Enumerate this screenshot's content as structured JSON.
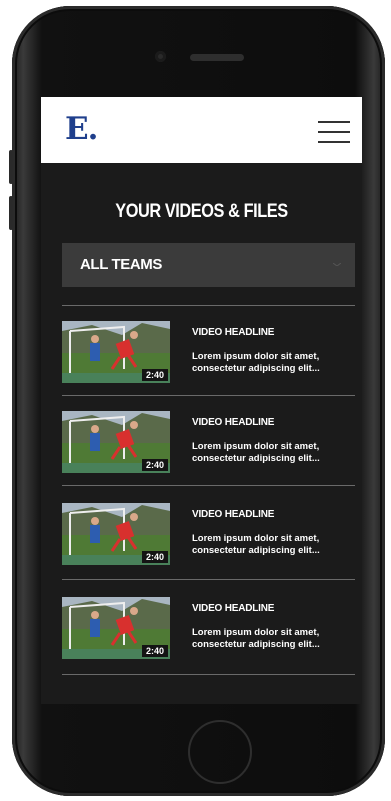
{
  "header": {
    "logo_text": "E.",
    "menu_icon": "hamburger-menu-icon"
  },
  "page_title": "YOUR VIDEOS & FILES",
  "filter": {
    "selected": "ALL TEAMS",
    "icon": "chevron-down-icon"
  },
  "videos": [
    {
      "headline": "VIDEO HEADLINE",
      "description": "Lorem ipsum dolor sit amet, consectetur adipiscing elit...",
      "duration": "2:40"
    },
    {
      "headline": "VIDEO HEADLINE",
      "description": "Lorem ipsum dolor sit amet, consectetur adipiscing elit...",
      "duration": "2:40"
    },
    {
      "headline": "VIDEO HEADLINE",
      "description": "Lorem ipsum dolor sit amet, consectetur adipiscing elit...",
      "duration": "2:40"
    },
    {
      "headline": "VIDEO HEADLINE",
      "description": "Lorem ipsum dolor sit amet, consectetur adipiscing elit...",
      "duration": "2:40"
    }
  ],
  "colors": {
    "brand": "#1f3f8c",
    "screen_bg": "#1b1b1b",
    "dropdown_bg": "#3b3b3b"
  }
}
